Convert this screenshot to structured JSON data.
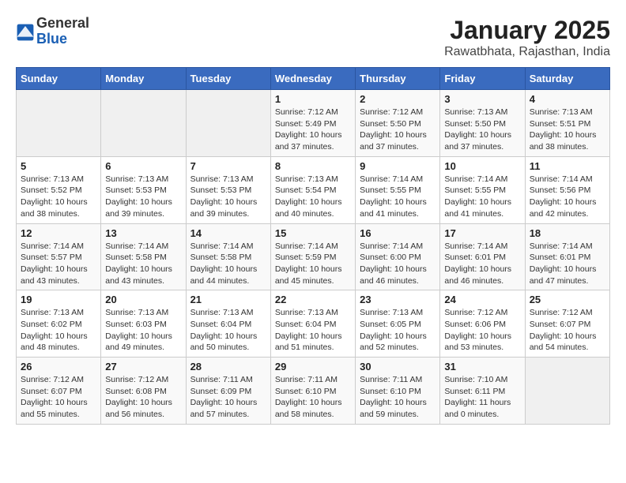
{
  "header": {
    "logo": {
      "general": "General",
      "blue": "Blue"
    },
    "title": "January 2025",
    "subtitle": "Rawatbhata, Rajasthan, India"
  },
  "weekdays": [
    "Sunday",
    "Monday",
    "Tuesday",
    "Wednesday",
    "Thursday",
    "Friday",
    "Saturday"
  ],
  "weeks": [
    [
      {
        "day": "",
        "info": ""
      },
      {
        "day": "",
        "info": ""
      },
      {
        "day": "",
        "info": ""
      },
      {
        "day": "1",
        "info": "Sunrise: 7:12 AM\nSunset: 5:49 PM\nDaylight: 10 hours\nand 37 minutes."
      },
      {
        "day": "2",
        "info": "Sunrise: 7:12 AM\nSunset: 5:50 PM\nDaylight: 10 hours\nand 37 minutes."
      },
      {
        "day": "3",
        "info": "Sunrise: 7:13 AM\nSunset: 5:50 PM\nDaylight: 10 hours\nand 37 minutes."
      },
      {
        "day": "4",
        "info": "Sunrise: 7:13 AM\nSunset: 5:51 PM\nDaylight: 10 hours\nand 38 minutes."
      }
    ],
    [
      {
        "day": "5",
        "info": "Sunrise: 7:13 AM\nSunset: 5:52 PM\nDaylight: 10 hours\nand 38 minutes."
      },
      {
        "day": "6",
        "info": "Sunrise: 7:13 AM\nSunset: 5:53 PM\nDaylight: 10 hours\nand 39 minutes."
      },
      {
        "day": "7",
        "info": "Sunrise: 7:13 AM\nSunset: 5:53 PM\nDaylight: 10 hours\nand 39 minutes."
      },
      {
        "day": "8",
        "info": "Sunrise: 7:13 AM\nSunset: 5:54 PM\nDaylight: 10 hours\nand 40 minutes."
      },
      {
        "day": "9",
        "info": "Sunrise: 7:14 AM\nSunset: 5:55 PM\nDaylight: 10 hours\nand 41 minutes."
      },
      {
        "day": "10",
        "info": "Sunrise: 7:14 AM\nSunset: 5:55 PM\nDaylight: 10 hours\nand 41 minutes."
      },
      {
        "day": "11",
        "info": "Sunrise: 7:14 AM\nSunset: 5:56 PM\nDaylight: 10 hours\nand 42 minutes."
      }
    ],
    [
      {
        "day": "12",
        "info": "Sunrise: 7:14 AM\nSunset: 5:57 PM\nDaylight: 10 hours\nand 43 minutes."
      },
      {
        "day": "13",
        "info": "Sunrise: 7:14 AM\nSunset: 5:58 PM\nDaylight: 10 hours\nand 43 minutes."
      },
      {
        "day": "14",
        "info": "Sunrise: 7:14 AM\nSunset: 5:58 PM\nDaylight: 10 hours\nand 44 minutes."
      },
      {
        "day": "15",
        "info": "Sunrise: 7:14 AM\nSunset: 5:59 PM\nDaylight: 10 hours\nand 45 minutes."
      },
      {
        "day": "16",
        "info": "Sunrise: 7:14 AM\nSunset: 6:00 PM\nDaylight: 10 hours\nand 46 minutes."
      },
      {
        "day": "17",
        "info": "Sunrise: 7:14 AM\nSunset: 6:01 PM\nDaylight: 10 hours\nand 46 minutes."
      },
      {
        "day": "18",
        "info": "Sunrise: 7:14 AM\nSunset: 6:01 PM\nDaylight: 10 hours\nand 47 minutes."
      }
    ],
    [
      {
        "day": "19",
        "info": "Sunrise: 7:13 AM\nSunset: 6:02 PM\nDaylight: 10 hours\nand 48 minutes."
      },
      {
        "day": "20",
        "info": "Sunrise: 7:13 AM\nSunset: 6:03 PM\nDaylight: 10 hours\nand 49 minutes."
      },
      {
        "day": "21",
        "info": "Sunrise: 7:13 AM\nSunset: 6:04 PM\nDaylight: 10 hours\nand 50 minutes."
      },
      {
        "day": "22",
        "info": "Sunrise: 7:13 AM\nSunset: 6:04 PM\nDaylight: 10 hours\nand 51 minutes."
      },
      {
        "day": "23",
        "info": "Sunrise: 7:13 AM\nSunset: 6:05 PM\nDaylight: 10 hours\nand 52 minutes."
      },
      {
        "day": "24",
        "info": "Sunrise: 7:12 AM\nSunset: 6:06 PM\nDaylight: 10 hours\nand 53 minutes."
      },
      {
        "day": "25",
        "info": "Sunrise: 7:12 AM\nSunset: 6:07 PM\nDaylight: 10 hours\nand 54 minutes."
      }
    ],
    [
      {
        "day": "26",
        "info": "Sunrise: 7:12 AM\nSunset: 6:07 PM\nDaylight: 10 hours\nand 55 minutes."
      },
      {
        "day": "27",
        "info": "Sunrise: 7:12 AM\nSunset: 6:08 PM\nDaylight: 10 hours\nand 56 minutes."
      },
      {
        "day": "28",
        "info": "Sunrise: 7:11 AM\nSunset: 6:09 PM\nDaylight: 10 hours\nand 57 minutes."
      },
      {
        "day": "29",
        "info": "Sunrise: 7:11 AM\nSunset: 6:10 PM\nDaylight: 10 hours\nand 58 minutes."
      },
      {
        "day": "30",
        "info": "Sunrise: 7:11 AM\nSunset: 6:10 PM\nDaylight: 10 hours\nand 59 minutes."
      },
      {
        "day": "31",
        "info": "Sunrise: 7:10 AM\nSunset: 6:11 PM\nDaylight: 11 hours\nand 0 minutes."
      },
      {
        "day": "",
        "info": ""
      }
    ]
  ]
}
